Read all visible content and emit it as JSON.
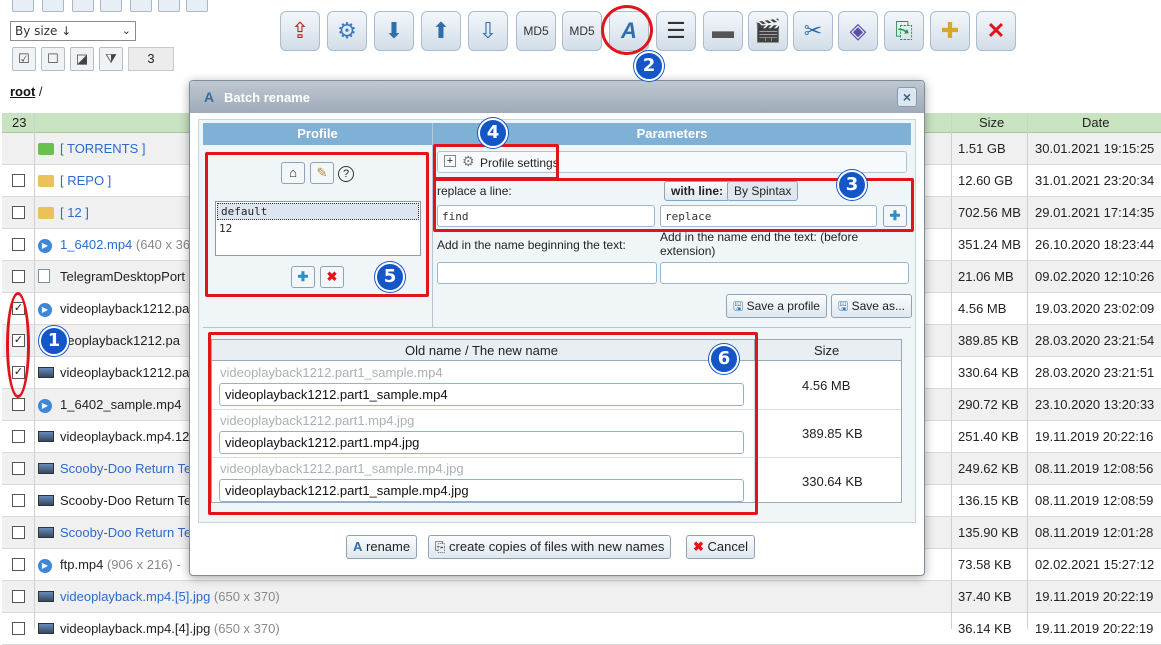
{
  "sort": {
    "value": "By size ↓"
  },
  "selection_count": "3",
  "breadcrumb": {
    "root": "root",
    "sep": "/"
  },
  "table": {
    "count": "23",
    "col_size": "Size",
    "col_date": "Date",
    "rows": [
      {
        "name": "[ TORRENTS ]",
        "dim": "",
        "size": "1.51 GB",
        "date": "30.01.2021 19:15:25",
        "icon": "folder-green-icon",
        "link": true,
        "checked": null
      },
      {
        "name": "[ REPO ]",
        "dim": "",
        "size": "12.60 GB",
        "date": "31.01.2021 23:20:34",
        "icon": "folder-icon",
        "link": true,
        "checked": false
      },
      {
        "name": "[ 12 ]",
        "dim": "",
        "size": "702.56 MB",
        "date": "29.01.2021 17:14:35",
        "icon": "folder-icon",
        "link": true,
        "checked": false
      },
      {
        "name": "1_6402.mp4",
        "dim": " (640 x 36",
        "size": "351.24 MB",
        "date": "26.10.2020 18:23:44",
        "icon": "play-icon",
        "link": true,
        "checked": false
      },
      {
        "name": "TelegramDesktopPort",
        "dim": "",
        "size": "21.06 MB",
        "date": "09.02.2020 12:10:26",
        "icon": "document-icon",
        "link": false,
        "checked": false
      },
      {
        "name": "videoplayback1212.pa",
        "dim": "",
        "size": "4.56 MB",
        "date": "19.03.2020 23:02:09",
        "icon": "play-icon",
        "link": false,
        "checked": true
      },
      {
        "name": "deoplayback1212.pa",
        "dim": "",
        "size": "389.85 KB",
        "date": "28.03.2020 23:21:54",
        "icon": "none",
        "link": false,
        "checked": true
      },
      {
        "name": "videoplayback1212.pa",
        "dim": "",
        "size": "330.64 KB",
        "date": "28.03.2020 23:21:51",
        "icon": "image-icon",
        "link": false,
        "checked": true
      },
      {
        "name": "1_6402_sample.mp4",
        "dim": "",
        "size": "290.72 KB",
        "date": "23.10.2020 13:20:33",
        "icon": "play-icon",
        "link": false,
        "checked": false
      },
      {
        "name": "videoplayback.mp4.12",
        "dim": "",
        "size": "251.40 KB",
        "date": "19.11.2019 20:22:16",
        "icon": "image-icon",
        "link": false,
        "checked": false
      },
      {
        "name": "Scooby-Doo Return Te",
        "dim": "",
        "size": "249.62 KB",
        "date": "08.11.2019 12:08:56",
        "icon": "image-icon",
        "link": true,
        "checked": false
      },
      {
        "name": "Scooby-Doo Return Te",
        "dim": "",
        "size": "136.15 KB",
        "date": "08.11.2019 12:08:59",
        "icon": "image-icon",
        "link": false,
        "checked": false
      },
      {
        "name": "Scooby-Doo Return Te",
        "dim": "",
        "size": "135.90 KB",
        "date": "08.11.2019 12:01:28",
        "icon": "image-icon",
        "link": true,
        "checked": false
      },
      {
        "name": "ftp.mp4",
        "dim": " (906 x 216) -",
        "size": "73.58 KB",
        "date": "02.02.2021 15:27:12",
        "icon": "play-icon",
        "link": false,
        "checked": false
      },
      {
        "name": "videoplayback.mp4.[5].jpg",
        "dim": " (650 x 370)",
        "size": "37.40 KB",
        "date": "19.11.2019 20:22:19",
        "icon": "image-icon",
        "link": true,
        "checked": false
      },
      {
        "name": "videoplayback.mp4.[4].jpg",
        "dim": " (650 x 370)",
        "size": "36.14 KB",
        "date": "19.11.2019 20:22:19",
        "icon": "image-icon",
        "link": false,
        "checked": false
      }
    ]
  },
  "dialog": {
    "title": "Batch rename",
    "profile_header": "Profile",
    "params_header": "Parameters",
    "profiles": [
      "default",
      "12"
    ],
    "profile_settings": "Profile settings",
    "replace_label": "replace a line:",
    "with_line": "with line:",
    "by_spintax": "By Spintax",
    "find_value": "find",
    "replace_value": "replace",
    "begin_label": "Add in the name beginning the text:",
    "end_label": "Add in the name end the text: (before extension)",
    "save_profile": "Save a profile",
    "save_as": "Save as...",
    "old_new_header": "Old name / The new name",
    "size_header": "Size",
    "files": [
      {
        "old": "videoplayback1212.part1_sample.mp4",
        "new": "videoplayback1212.part1_sample.mp4",
        "size": "4.56 MB"
      },
      {
        "old": "videoplayback1212.part1.mp4.jpg",
        "new": "videoplayback1212.part1.mp4.jpg",
        "size": "389.85 KB"
      },
      {
        "old": "videoplayback1212.part1_sample.mp4.jpg",
        "new": "videoplayback1212.part1_sample.mp4.jpg",
        "size": "330.64 KB"
      }
    ],
    "rename": "rename",
    "copies": "create copies of files with new names",
    "cancel": "Cancel"
  },
  "markers": [
    "1",
    "2",
    "3",
    "4",
    "5",
    "6"
  ]
}
